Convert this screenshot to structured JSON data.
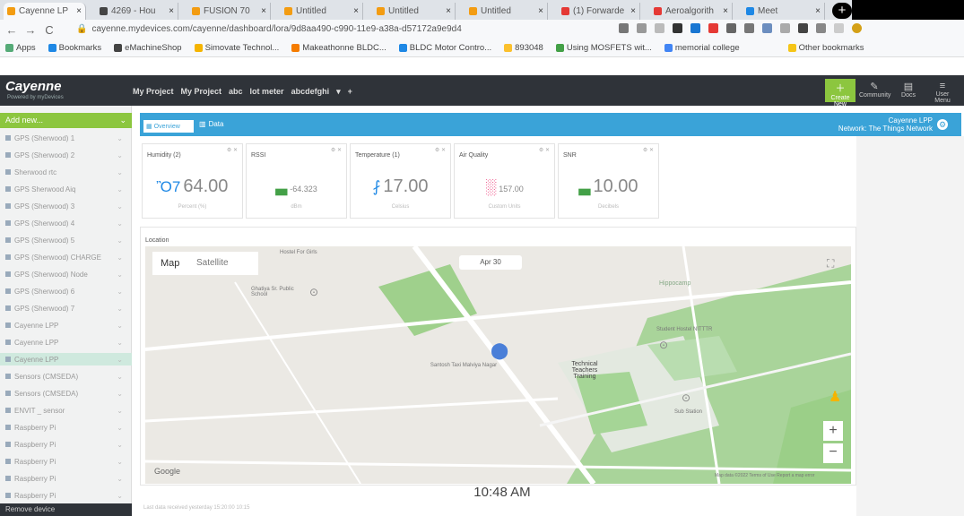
{
  "browser": {
    "tabs": [
      {
        "label": "Cayenne LP",
        "color": "#f39c12",
        "active": true
      },
      {
        "label": "4269 - Hou",
        "color": "#444"
      },
      {
        "label": "FUSION 70",
        "color": "#f39c12"
      },
      {
        "label": "Untitled",
        "color": "#f39c12"
      },
      {
        "label": "Untitled",
        "color": "#f39c12"
      },
      {
        "label": "Untitled",
        "color": "#f39c12"
      },
      {
        "label": "(1) Forwarde",
        "color": "#e53935"
      },
      {
        "label": "Aeroalgorith",
        "color": "#e53935"
      },
      {
        "label": "Meet",
        "color": "#1e88e5"
      }
    ],
    "url": "cayenne.mydevices.com/cayenne/dashboard/lora/9d8aa490-c990-11e9-a38a-d57172a9e9d4",
    "bookmarks": [
      "Apps",
      "Bookmarks",
      "eMachineShop",
      "Simovate Technol...",
      "Makeathonne BLDC...",
      "BLDC Motor Contro...",
      "893048",
      "Using MOSFETS wit...",
      "memorial college",
      "Other bookmarks"
    ]
  },
  "header": {
    "logo": "Cayenne",
    "logo_sub": "Powered by myDevices",
    "nav": [
      "My Project",
      "My Project",
      "abc",
      "lot meter",
      "abcdefghi"
    ],
    "right_buttons": [
      {
        "label": "Create New",
        "icon": "plus-icon"
      },
      {
        "label": "Community",
        "icon": "community-icon"
      },
      {
        "label": "Docs",
        "icon": "docs-icon"
      },
      {
        "label": "User Menu",
        "icon": "menu-icon"
      }
    ]
  },
  "sidebar": {
    "add_new": "Add new...",
    "items": [
      {
        "label": "GPS (Sherwood) 1",
        "selected": false
      },
      {
        "label": "GPS (Sherwood) 2",
        "selected": false
      },
      {
        "label": "Sherwood rtc",
        "selected": false
      },
      {
        "label": "GPS Sherwood Aiq",
        "selected": false
      },
      {
        "label": "GPS (Sherwood) 3",
        "selected": false
      },
      {
        "label": "GPS (Sherwood) 4",
        "selected": false
      },
      {
        "label": "GPS (Sherwood) 5",
        "selected": false
      },
      {
        "label": "GPS (Sherwood) CHARGE",
        "selected": false
      },
      {
        "label": "GPS (Sherwood) Node",
        "selected": false
      },
      {
        "label": "GPS (Sherwood) 6",
        "selected": false
      },
      {
        "label": "GPS (Sherwood) 7",
        "selected": false
      },
      {
        "label": "Cayenne LPP",
        "selected": false
      },
      {
        "label": "Cayenne LPP",
        "selected": false
      },
      {
        "label": "Cayenne LPP",
        "selected": true
      },
      {
        "label": "Sensors (CMSEDA)",
        "selected": false
      },
      {
        "label": "Sensors (CMSEDA)",
        "selected": false
      },
      {
        "label": "ENVIT _ sensor",
        "selected": false
      },
      {
        "label": "Raspberry Pi",
        "selected": false
      },
      {
        "label": "Raspberry Pi",
        "selected": false
      },
      {
        "label": "Raspberry Pi",
        "selected": false
      },
      {
        "label": "Raspberry Pi",
        "selected": false
      },
      {
        "label": "Raspberry Pi",
        "selected": false
      }
    ],
    "bottom": "Remove device"
  },
  "dashboard": {
    "tab_overview": "Overview",
    "tab_data": "Data",
    "device_name": "Cayenne LPP",
    "device_sub": "Network: The Things Network",
    "widgets": [
      {
        "title": "Humidity (2)",
        "value": "64.00",
        "sub": "Percent (%)",
        "icon": "Ὂ7",
        "color": "#1e88e5"
      },
      {
        "title": "RSSI",
        "value": "-64.323",
        "sub": "dBm",
        "icon": "▃",
        "color": "#43a047"
      },
      {
        "title": "Temperature (1)",
        "value": "17.00",
        "sub": "Celsius",
        "icon": "⨏",
        "color": "#1e88e5"
      },
      {
        "title": "Air Quality",
        "value": "157.00",
        "sub": "Custom Units",
        "icon": "░",
        "color": "#e91e63"
      },
      {
        "title": "SNR",
        "value": "10.00",
        "sub": "Decibels",
        "icon": "▃",
        "color": "#43a047"
      }
    ],
    "location_label": "Location",
    "map": {
      "type_map": "Map",
      "type_sat": "Satellite",
      "date_pill": "Apr 30",
      "places": [
        "Hostel For Girls",
        "Ghatiya Sr. Public School",
        "Hippocamp",
        "Student Hostel NITTTR",
        "Santosh Taxi Malviya Nagar",
        "Technical Teachers Training",
        "Sub Station",
        "Google"
      ],
      "attribution": "Map data ©2022  Terms of Use  Report a map error"
    },
    "timestamp": "10:48 AM",
    "status": "Last data received yesterday 15:20:00 10:15"
  }
}
